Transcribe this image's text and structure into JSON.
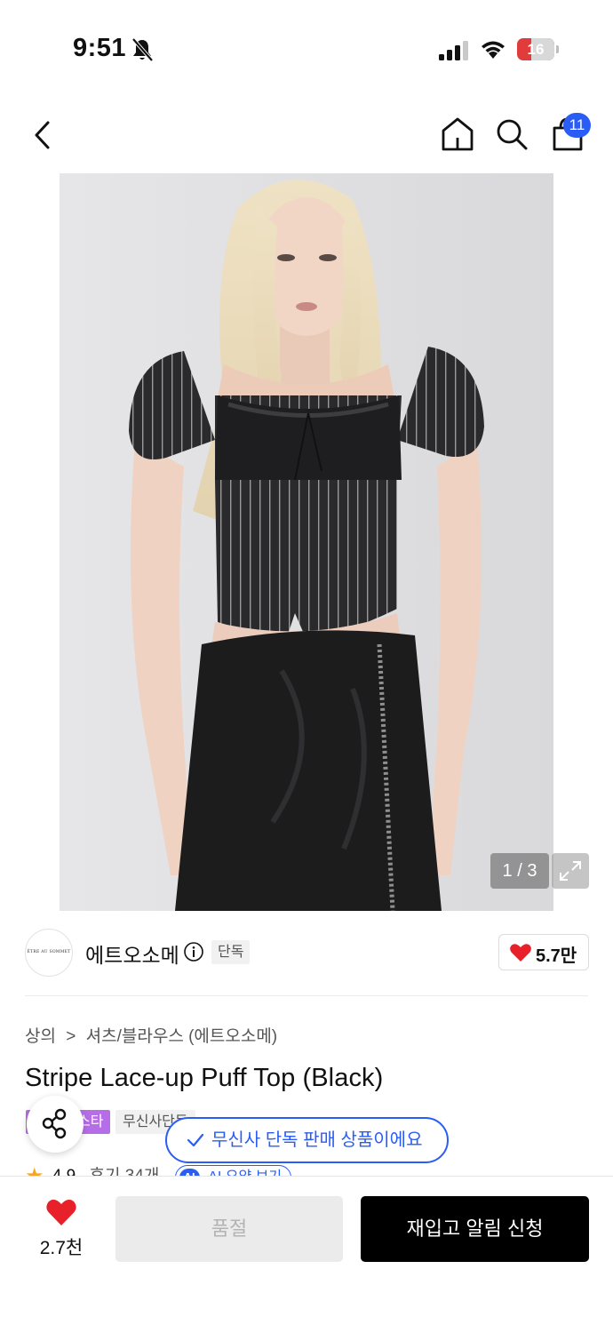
{
  "status_bar": {
    "time": "9:51",
    "battery_level": "16",
    "battery_color": "#e23b3b"
  },
  "nav": {
    "cart_badge_count": "11",
    "icons": [
      "back-chevron-icon",
      "home-icon",
      "search-icon",
      "shopping-bag-icon"
    ]
  },
  "gallery": {
    "counter": "1 / 3",
    "current_index": 1,
    "total": 3
  },
  "brand": {
    "logo_text": "ÊTRE AU SOMMET",
    "name": "에트오소메",
    "exclusive_tag": "단독",
    "likes": "5.7만"
  },
  "product": {
    "breadcrumb": [
      "상의",
      ">",
      "셔츠/블라우스 (에트오소메)"
    ],
    "title": "Stripe Lace-up Puff Top (Black)",
    "tags": [
      "스타",
      "무신사단독"
    ],
    "rating": "4.9",
    "reviews": "후기 34개",
    "ai_badge": "AI",
    "ai_summary": "AI 요약 보기"
  },
  "toast": {
    "message": "무신사 단독 판매 상품이에요"
  },
  "bottom_bar": {
    "wish_count": "2.7천",
    "soldout_label": "품절",
    "restock_label": "재입고 알림 신청"
  },
  "colors": {
    "accent_blue": "#2a5cf6",
    "heart_red": "#e8202a",
    "star_purple": "#b66de8"
  }
}
